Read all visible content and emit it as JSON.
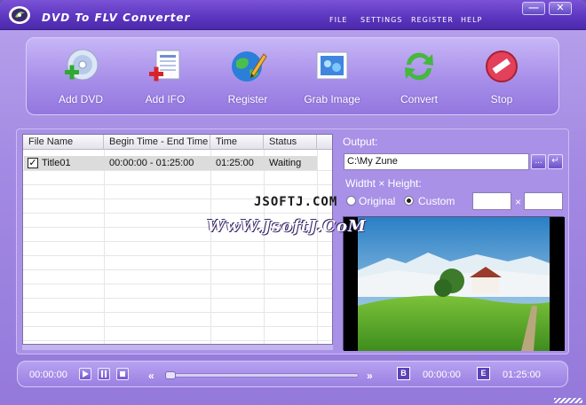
{
  "window": {
    "title": "DVD To FLV Converter",
    "menu": [
      "FILE",
      "SETTINGS",
      "REGISTER",
      "HELP"
    ],
    "minimize": "—",
    "close": "✕"
  },
  "toolbar": {
    "add_dvd": "Add DVD",
    "add_ifo": "Add IFO",
    "register": "Register",
    "grab_image": "Grab Image",
    "convert": "Convert",
    "stop": "Stop"
  },
  "file_table": {
    "columns": [
      "File Name",
      "Begin Time - End Time",
      "Time",
      "Status"
    ],
    "rows": [
      {
        "checked": "✓",
        "file_name": "Title01",
        "range": "00:00:00 - 01:25:00",
        "time": "01:25:00",
        "status": "Waiting"
      }
    ]
  },
  "output": {
    "label": "Output:",
    "value": "C:\\My Zune",
    "browse": "...",
    "open": "↵"
  },
  "size": {
    "label": "Widtht × Height:",
    "original": "Original",
    "custom": "Custom",
    "selected": "custom",
    "separator": "×",
    "width": "",
    "height": ""
  },
  "player": {
    "current_time": "00:00:00",
    "rewind": "«",
    "forward": "»",
    "begin_label": "B",
    "begin_time": "00:00:00",
    "end_label": "E",
    "end_time": "01:25:00",
    "progress": 0
  },
  "watermark": {
    "line1": "JSOFTJ.COM",
    "line2": "WwW.JsoftJ.CoM"
  },
  "colors": {
    "accent": "#a38ae3",
    "titlebar": "#5b35bf"
  }
}
